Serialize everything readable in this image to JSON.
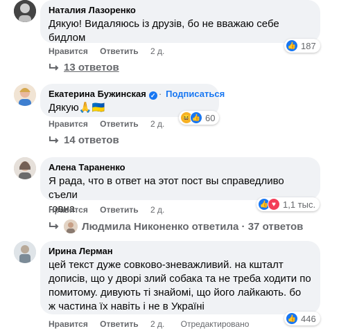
{
  "comments": [
    {
      "author": "Наталия Лазоренко",
      "text_lines": [
        "Дякую! Видаляюсь із друзів, бо не вважаю себе",
        "бидлом"
      ],
      "like_label": "Нравится",
      "reply_label": "Ответить",
      "time": "2 д.",
      "reaction_count": "187",
      "replies_label": "13 ответов"
    },
    {
      "author": "Екатерина Бужинская",
      "verified_mark": "✓",
      "subscribe_dot": "·",
      "subscribe_label": "Подписаться",
      "text": "Дякую",
      "text_emoji": "🙏🇺🇦",
      "like_label": "Нравится",
      "reply_label": "Ответить",
      "time": "2 д.",
      "reaction_count": "60",
      "replies_label": "14 ответов"
    },
    {
      "author": "Алена Тараненко",
      "text_lines": [
        "Я рада, что в ответ на этот пост вы справедливо съели",
        "говна."
      ],
      "like_label": "Нравится",
      "reply_label": "Ответить",
      "time": "2 д.",
      "reaction_count": "1,1 тыс.",
      "replies_label": "Людмила Никоненко ответила · 37 ответов"
    },
    {
      "author": "Ирина Лерман",
      "text_lines": [
        "цей текст дуже совково-зневажливий. на кшталт",
        "дописів, що у дворі злий собака та не треба ходити по",
        "помитому. дивують ті знайомі, що його лайкають. бо",
        "ж частина їх навіть і не в Україні"
      ],
      "like_label": "Нравится",
      "reply_label": "Ответить",
      "time": "2 д.",
      "edited_label": "Отредактировано",
      "reaction_count": "446"
    }
  ],
  "icons": {
    "like": "thumbs-up-icon",
    "love": "heart-icon",
    "haha": "haha-icon",
    "reply_arrow": "reply-arrow-icon"
  },
  "colors": {
    "bubble_bg": "#f0f2f5",
    "secondary_text": "#65676b",
    "accent": "#1877f2"
  }
}
